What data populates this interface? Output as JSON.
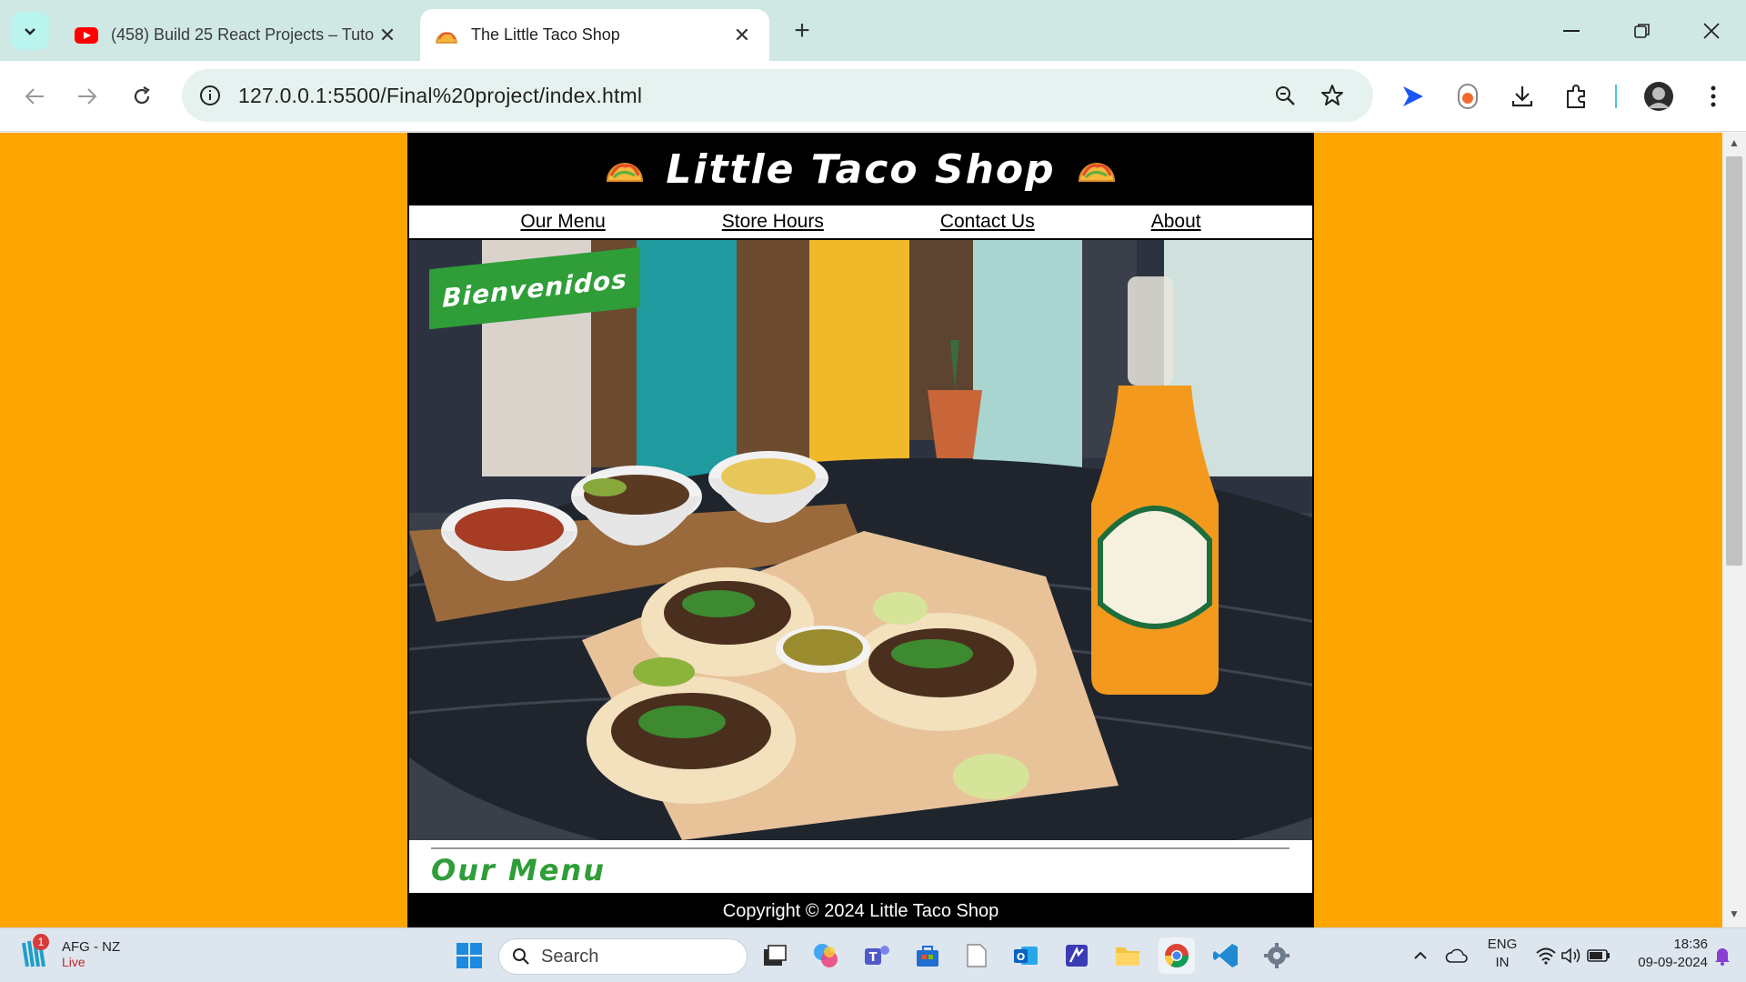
{
  "browser": {
    "tabs": [
      {
        "title": "(458) Build 25 React Projects – Tuto",
        "active": false,
        "favicon": "youtube-icon"
      },
      {
        "title": "The Little Taco Shop",
        "active": true,
        "favicon": "taco-icon"
      }
    ],
    "address": "127.0.0.1:5500/Final%20project/index.html"
  },
  "site": {
    "title": "Little Taco Shop",
    "nav": [
      "Our Menu",
      "Store Hours",
      "Contact Us",
      "About"
    ],
    "hero_banner": "Bienvenidos",
    "section_heading": "Our Menu",
    "footer": "Copyright © 2024 Little Taco Shop",
    "colors": {
      "page_bg": "#ffa500",
      "header_bg": "#000000",
      "accent_green": "#2f9d38"
    }
  },
  "taskbar": {
    "score_title": "AFG - NZ",
    "score_status": "Live",
    "score_badge": "1",
    "search_label": "Search",
    "lang_line1": "ENG",
    "lang_line2": "IN",
    "time": "18:36",
    "date": "09-09-2024"
  }
}
